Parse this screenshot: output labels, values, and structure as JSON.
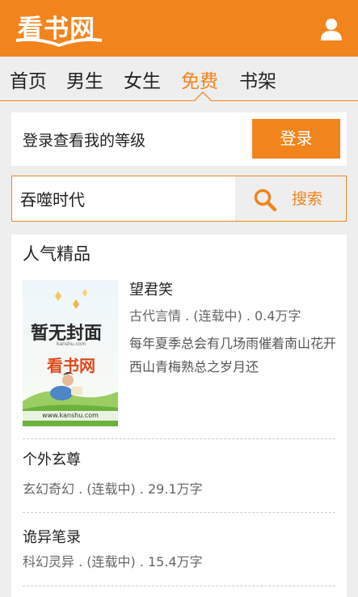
{
  "header": {
    "logo_text": "看书网",
    "user_icon": "user-icon"
  },
  "nav": {
    "tabs": [
      {
        "label": "首页",
        "active": false
      },
      {
        "label": "男生",
        "active": false
      },
      {
        "label": "女生",
        "active": false
      },
      {
        "label": "免费",
        "active": true
      },
      {
        "label": "书架",
        "active": false
      }
    ]
  },
  "login": {
    "prompt": "登录查看我的等级",
    "button_label": "登录"
  },
  "search": {
    "value": "吞噬时代",
    "button_label": "搜索",
    "icon": "search-icon"
  },
  "featured": {
    "title": "人气精品",
    "cover": {
      "title": "暂无封面",
      "site": "kanshu.com",
      "logo": "看书网",
      "url": "www.kanshu.com"
    },
    "books": [
      {
        "title": "望君笑",
        "meta": "古代言情 . (连载中) . 0.4万字",
        "description": "每年夏季总会有几场雨催着南山花开 西山青梅熟总之岁月还"
      },
      {
        "title": "个外玄尊",
        "meta": "玄幻奇幻 . (连载中) . 29.1万字"
      },
      {
        "title": "诡异笔录",
        "meta": "科幻灵异 . (连载中) . 15.4万字"
      }
    ]
  },
  "colors": {
    "accent": "#f2841d",
    "background": "#eeeeee"
  }
}
